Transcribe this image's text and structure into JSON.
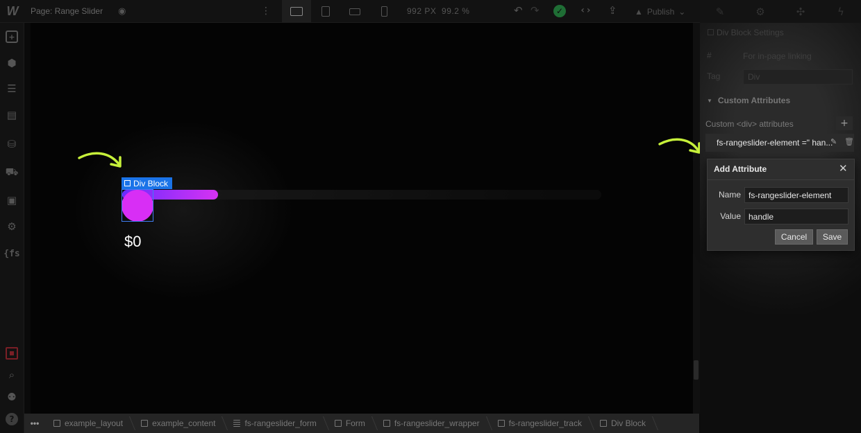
{
  "topbar": {
    "logo": "W",
    "page_label": "Page: Range Slider",
    "viewport_width": "992 PX",
    "zoom": "99.2 %",
    "publish_label": "Publish"
  },
  "canvas": {
    "selection_label": "Div Block",
    "price_text": "$0",
    "slider": {
      "fill_fraction": 0.2
    },
    "colors": {
      "handle": "#d82ef5",
      "fill_start": "#6a2cff",
      "fill_end": "#d632f2",
      "arrow": "#c6f03a",
      "selection": "#1a73e8"
    }
  },
  "breadcrumb": {
    "more": "•••",
    "items": [
      {
        "label": "example_layout",
        "icon": "box-icon"
      },
      {
        "label": "example_content",
        "icon": "box-icon"
      },
      {
        "label": "fs-rangeslider_form",
        "icon": "form-icon"
      },
      {
        "label": "Form",
        "icon": "box-icon"
      },
      {
        "label": "fs-rangeslider_wrapper",
        "icon": "box-icon"
      },
      {
        "label": "fs-rangeslider_track",
        "icon": "box-icon"
      },
      {
        "label": "Div Block",
        "icon": "box-icon"
      }
    ]
  },
  "panel": {
    "settings_title": "Div Block Settings",
    "id_placeholder": "For in-page linking",
    "tag_label": "Tag",
    "tag_value": "Div",
    "section_title": "Custom Attributes",
    "attr_caption": "Custom <div> attributes",
    "attr_row": "fs-rangeslider-element =\" han..."
  },
  "dialog": {
    "title": "Add Attribute",
    "name_label": "Name",
    "name_value": "fs-rangeslider-element",
    "value_label": "Value",
    "value_value": "handle",
    "cancel_label": "Cancel",
    "save_label": "Save"
  }
}
